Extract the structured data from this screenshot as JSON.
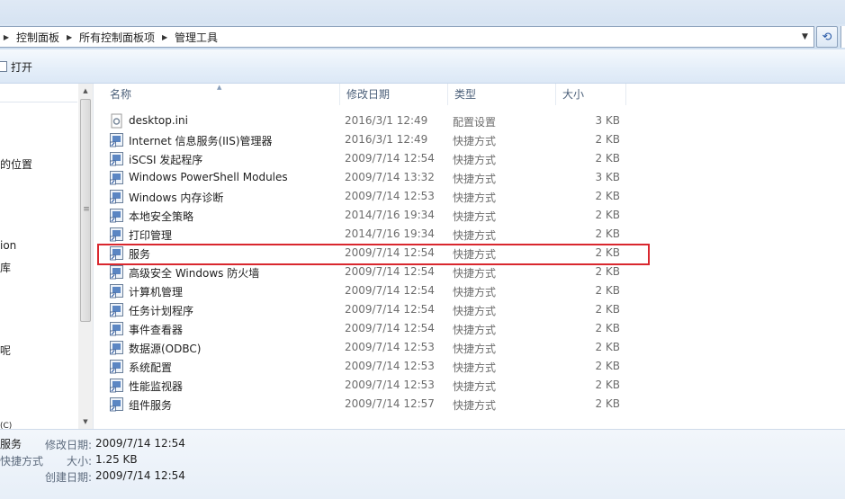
{
  "breadcrumb": [
    "控制面板",
    "所有控制面板项",
    "管理工具"
  ],
  "toolbar": {
    "open_label": "打开"
  },
  "nav_fragments": [
    "的位置",
    "ion",
    "库",
    "呢",
    "(C)"
  ],
  "columns": {
    "name": "名称",
    "modified": "修改日期",
    "type": "类型",
    "size": "大小"
  },
  "files": [
    {
      "name": "desktop.ini",
      "modified": "2016/3/1 12:49",
      "type": "配置设置",
      "size": "3 KB",
      "icon": "settings-file-icon"
    },
    {
      "name": "Internet 信息服务(IIS)管理器",
      "modified": "2016/3/1 12:49",
      "type": "快捷方式",
      "size": "2 KB",
      "icon": "iis-manager-icon"
    },
    {
      "name": "iSCSI 发起程序",
      "modified": "2009/7/14 12:54",
      "type": "快捷方式",
      "size": "2 KB",
      "icon": "iscsi-icon"
    },
    {
      "name": "Windows PowerShell Modules",
      "modified": "2009/7/14 13:32",
      "type": "快捷方式",
      "size": "3 KB",
      "icon": "powershell-icon"
    },
    {
      "name": "Windows 内存诊断",
      "modified": "2009/7/14 12:53",
      "type": "快捷方式",
      "size": "2 KB",
      "icon": "memory-diagnostic-icon"
    },
    {
      "name": "本地安全策略",
      "modified": "2014/7/16 19:34",
      "type": "快捷方式",
      "size": "2 KB",
      "icon": "security-policy-icon"
    },
    {
      "name": "打印管理",
      "modified": "2014/7/16 19:34",
      "type": "快捷方式",
      "size": "2 KB",
      "icon": "print-management-icon"
    },
    {
      "name": "服务",
      "modified": "2009/7/14 12:54",
      "type": "快捷方式",
      "size": "2 KB",
      "icon": "services-icon"
    },
    {
      "name": "高级安全 Windows 防火墙",
      "modified": "2009/7/14 12:54",
      "type": "快捷方式",
      "size": "2 KB",
      "icon": "firewall-icon"
    },
    {
      "name": "计算机管理",
      "modified": "2009/7/14 12:54",
      "type": "快捷方式",
      "size": "2 KB",
      "icon": "computer-management-icon"
    },
    {
      "name": "任务计划程序",
      "modified": "2009/7/14 12:54",
      "type": "快捷方式",
      "size": "2 KB",
      "icon": "task-scheduler-icon"
    },
    {
      "name": "事件查看器",
      "modified": "2009/7/14 12:54",
      "type": "快捷方式",
      "size": "2 KB",
      "icon": "event-viewer-icon"
    },
    {
      "name": "数据源(ODBC)",
      "modified": "2009/7/14 12:53",
      "type": "快捷方式",
      "size": "2 KB",
      "icon": "odbc-icon"
    },
    {
      "name": "系统配置",
      "modified": "2009/7/14 12:53",
      "type": "快捷方式",
      "size": "2 KB",
      "icon": "system-config-icon"
    },
    {
      "name": "性能监视器",
      "modified": "2009/7/14 12:53",
      "type": "快捷方式",
      "size": "2 KB",
      "icon": "performance-monitor-icon"
    },
    {
      "name": "组件服务",
      "modified": "2009/7/14 12:57",
      "type": "快捷方式",
      "size": "2 KB",
      "icon": "component-services-icon"
    }
  ],
  "selected_file": "服务",
  "details": {
    "name": "服务",
    "type": "快捷方式",
    "modified_label": "修改日期:",
    "modified_value": "2009/7/14 12:54",
    "size_label": "大小:",
    "size_value": "1.25 KB",
    "created_label": "创建日期:",
    "created_value": "2009/7/14 12:54"
  },
  "colors": {
    "highlight_border": "#d9272e",
    "header_text": "#4c607a",
    "meta_text": "#6d6d6d"
  }
}
